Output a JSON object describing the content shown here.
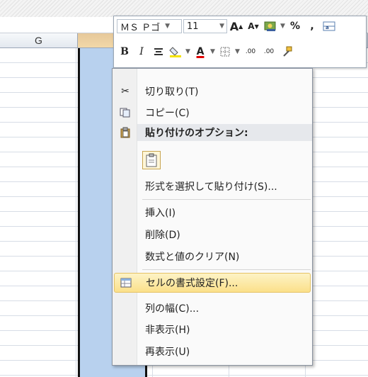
{
  "column_header": {
    "g": "G"
  },
  "mini_toolbar": {
    "font_name": "ＭＳ Ｐゴ",
    "font_size": "11",
    "grow_font": "A",
    "shrink_font": "A",
    "percent": "%",
    "comma": ",",
    "bold": "B",
    "italic": "I",
    "font_color": "A",
    "inc_decimal": ".00",
    "dec_decimal": ".00"
  },
  "context_menu": {
    "cut": "切り取り(T)",
    "copy": "コピー(C)",
    "paste_options": "貼り付けのオプション:",
    "paste_special": "形式を選択して貼り付け(S)...",
    "insert": "挿入(I)",
    "delete": "削除(D)",
    "clear": "数式と値のクリア(N)",
    "format_cells": "セルの書式設定(F)...",
    "column_width": "列の幅(C)...",
    "hide": "非表示(H)",
    "unhide": "再表示(U)"
  }
}
